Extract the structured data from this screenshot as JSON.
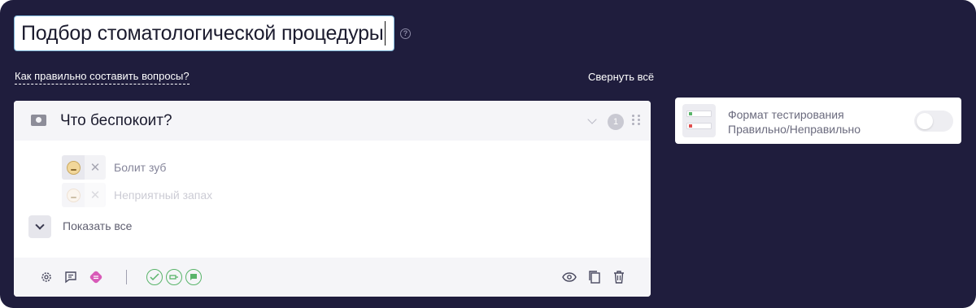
{
  "quiz": {
    "title": "Подбор стоматологической процедуры",
    "help_icon": "question-circle-icon"
  },
  "links": {
    "how_to": "Как правильно составить вопросы?",
    "collapse_all": "Свернуть всё"
  },
  "question": {
    "title": "Что беспокоит?",
    "count": "1",
    "answers": [
      {
        "text": "Болит зуб",
        "icon": "toothache-emoji-icon"
      },
      {
        "text": "Неприятный запах",
        "icon": "smell-emoji-icon"
      }
    ],
    "show_all": "Показать все"
  },
  "footer": {
    "icons_left": [
      "gear-icon",
      "comment-icon",
      "logic-icon"
    ],
    "icons_green": [
      "check-answer-icon",
      "range-icon",
      "message-icon"
    ],
    "icons_right": [
      "eye-icon",
      "copy-icon",
      "trash-icon"
    ]
  },
  "side_panel": {
    "title": "Формат тестирования Правильно/Неправильно",
    "toggle_on": false
  },
  "colors": {
    "background": "#1f1d3d",
    "accent_green": "#59b46a",
    "logic_icon": "#d85ab8"
  }
}
